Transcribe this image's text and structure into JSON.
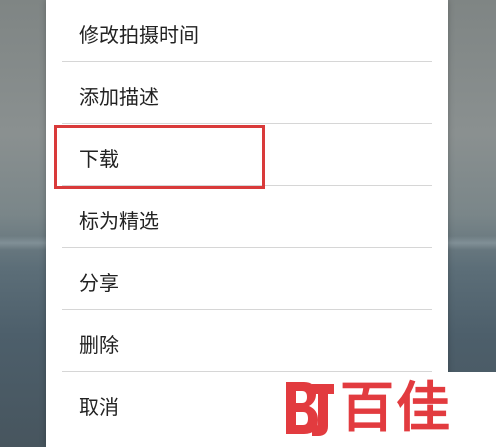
{
  "menu": {
    "items": [
      {
        "label": "修改拍摄时间"
      },
      {
        "label": "添加描述"
      },
      {
        "label": "下载"
      },
      {
        "label": "标为精选"
      },
      {
        "label": "分享"
      },
      {
        "label": "删除"
      },
      {
        "label": "取消"
      }
    ]
  },
  "highlight": {
    "target": "下载",
    "color": "#d93a3a"
  },
  "watermark": {
    "text": "百佳",
    "color": "#e23b3f"
  }
}
